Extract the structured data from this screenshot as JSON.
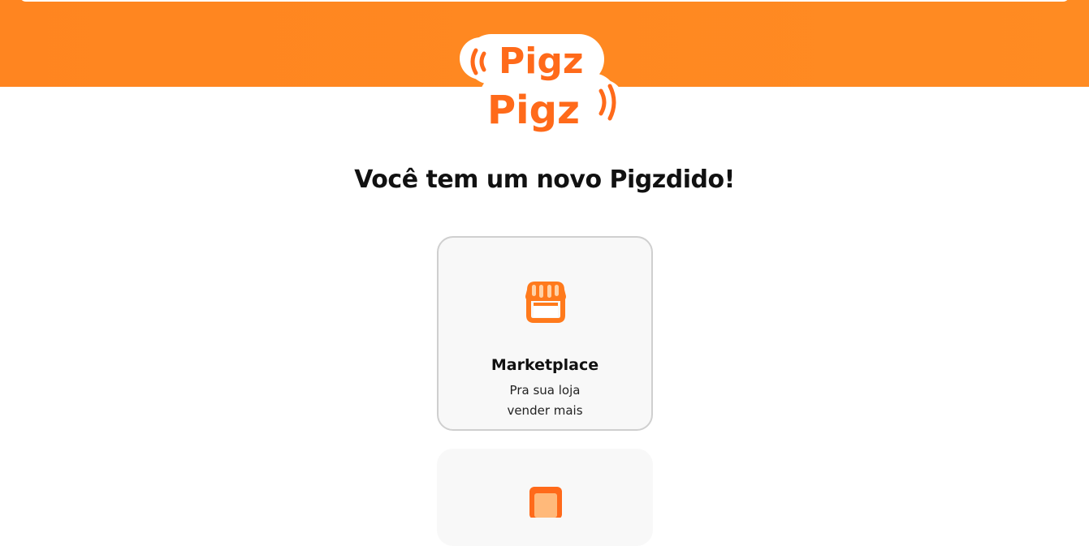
{
  "brand": {
    "logo_text_top": "Pigz",
    "logo_text_bottom": "Pigz",
    "primary_color": "#ff8520",
    "accent_color": "#ff6a1a"
  },
  "headline": "Você tem um novo Pigzdido!",
  "cards": [
    {
      "icon": "storefront-icon",
      "title": "Marketplace",
      "desc_line1": "Pra sua loja",
      "desc_line2": "vender mais",
      "selected": true
    },
    {
      "icon": "app-icon",
      "selected": false
    }
  ]
}
